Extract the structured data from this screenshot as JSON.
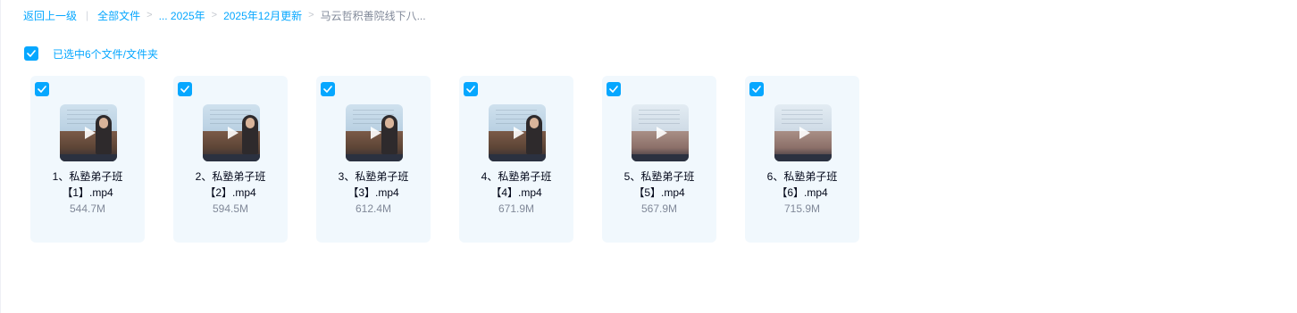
{
  "breadcrumb": {
    "back": "返回上一级",
    "all_files": "全部文件",
    "ellipsis_year": "... 2025年",
    "month": "2025年12月更新",
    "current": "马云哲积善院线下八...",
    "separator": ">"
  },
  "selection": {
    "label": "已选中6个文件/文件夹"
  },
  "files": [
    {
      "name_line1": "1、私塾弟子班",
      "name_line2": "【1】.mp4",
      "size": "544.7M"
    },
    {
      "name_line1": "2、私塾弟子班",
      "name_line2": "【2】.mp4",
      "size": "594.5M"
    },
    {
      "name_line1": "3、私塾弟子班",
      "name_line2": "【3】.mp4",
      "size": "612.4M"
    },
    {
      "name_line1": "4、私塾弟子班",
      "name_line2": "【4】.mp4",
      "size": "671.9M"
    },
    {
      "name_line1": "5、私塾弟子班",
      "name_line2": "【5】.mp4",
      "size": "567.9M"
    },
    {
      "name_line1": "6、私塾弟子班",
      "name_line2": "【6】.mp4",
      "size": "715.9M"
    }
  ],
  "colors": {
    "accent": "#06a7ff",
    "card_bg": "#f1f8fd",
    "muted": "#818999"
  }
}
